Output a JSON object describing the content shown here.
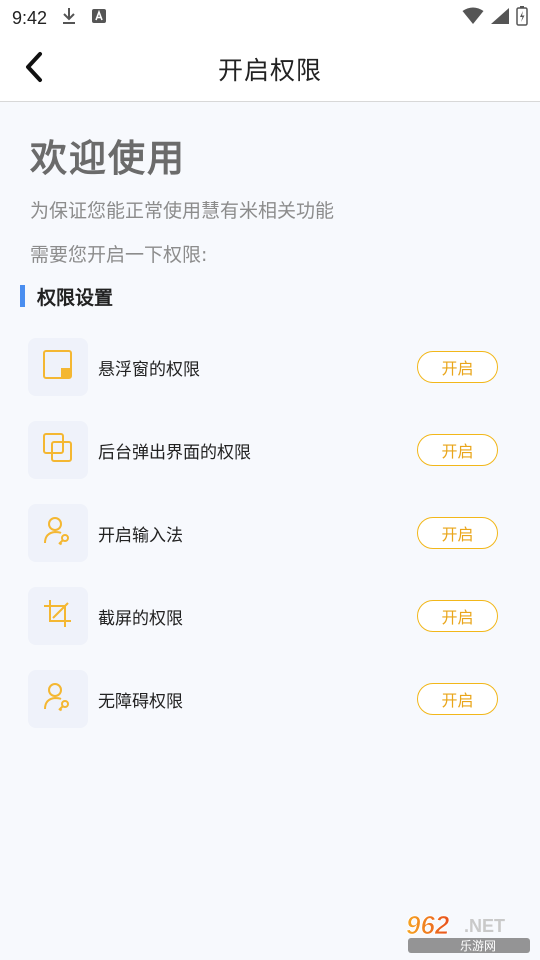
{
  "status_bar": {
    "time": "9:42",
    "icons_left": [
      "download-icon",
      "a-notification-icon"
    ],
    "icons_right": [
      "wifi-icon",
      "cell-signal-icon",
      "battery-icon"
    ]
  },
  "header": {
    "title": "开启权限",
    "back_icon": "chevron-left-icon"
  },
  "intro": {
    "welcome": "欢迎使用",
    "line1": "为保证您能正常使用慧有米相关功能",
    "line2": "需要您开启一下权限:"
  },
  "section": {
    "title": "权限设置",
    "accent_color": "#4a8ef0"
  },
  "permissions": [
    {
      "label": "悬浮窗的权限",
      "button": "开启",
      "icon": "floating-window-icon"
    },
    {
      "label": "后台弹出界面的权限",
      "button": "开启",
      "icon": "overlapping-windows-icon"
    },
    {
      "label": "开启输入法",
      "button": "开启",
      "icon": "user-key-icon"
    },
    {
      "label": "截屏的权限",
      "button": "开启",
      "icon": "crop-icon"
    },
    {
      "label": "无障碍权限",
      "button": "开启",
      "icon": "user-key-icon"
    }
  ],
  "colors": {
    "button_border": "#f2b71a",
    "button_text": "#e9a51a",
    "icon_color": "#f4b732",
    "background": "#f7f9fd"
  },
  "watermark": {
    "text_top": "962.NET",
    "text_bottom": "乐游网"
  }
}
